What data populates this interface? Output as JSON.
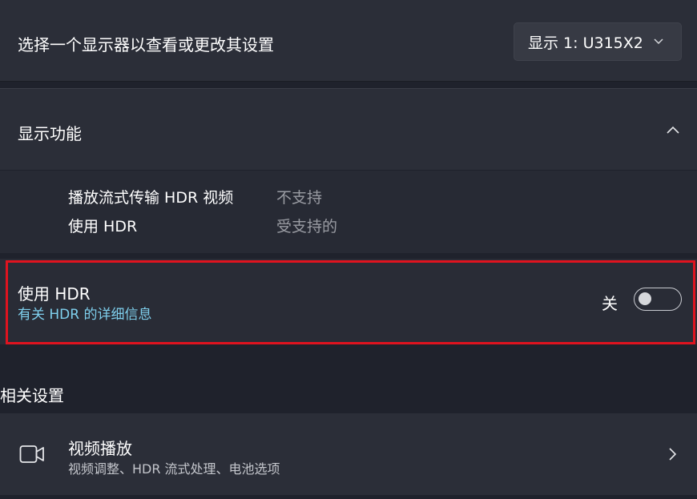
{
  "display_select": {
    "label": "选择一个显示器以查看或更改其设置",
    "selected_display": "显示 1: U315X2",
    "dropdown_icon": "chevron-down-icon"
  },
  "display_capabilities": {
    "title": "显示功能",
    "collapse_icon": "chevron-up-icon",
    "rows": [
      {
        "label": "播放流式传输 HDR 视频",
        "value": "不支持"
      },
      {
        "label": "使用 HDR",
        "value": "受支持的"
      }
    ]
  },
  "hdr_setting": {
    "title": "使用 HDR",
    "link": "有关 HDR 的详细信息",
    "toggle_state_label": "关",
    "toggle_on": false,
    "highlight_color": "#e0131f"
  },
  "related_settings": {
    "title": "相关设置",
    "items": [
      {
        "title": "视频播放",
        "subtitle": "视频调整、HDR 流式处理、电池选项",
        "icon": "video-camera-icon",
        "nav_icon": "chevron-right-icon"
      }
    ]
  },
  "colors": {
    "background": "#1f222c",
    "card": "#2b2e38",
    "link": "#7fd0ee",
    "secondary_text": "#9a9ca3"
  }
}
